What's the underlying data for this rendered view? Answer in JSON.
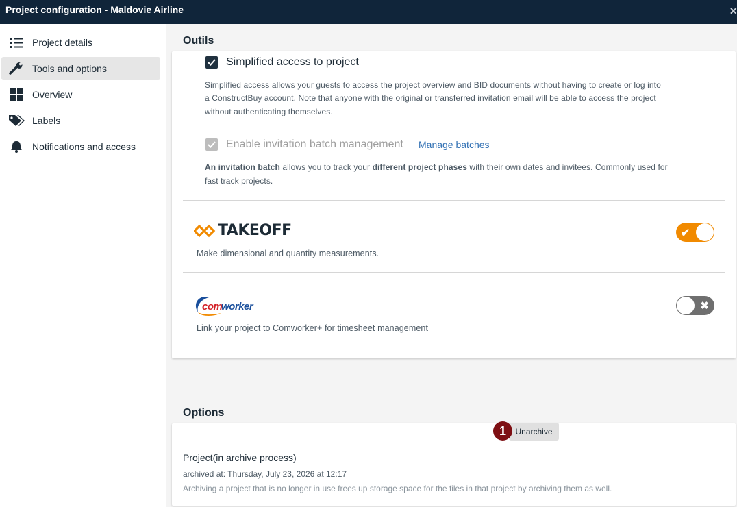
{
  "window": {
    "title": "Project configuration - Maldovie Airline",
    "close_glyph": "×"
  },
  "sidebar": {
    "items": [
      {
        "label": "Project details",
        "icon": "list-icon"
      },
      {
        "label": "Tools and options",
        "icon": "wrench-icon",
        "active": true
      },
      {
        "label": "Overview",
        "icon": "grid-icon"
      },
      {
        "label": "Labels",
        "icon": "tags-icon"
      },
      {
        "label": "Notifications and access",
        "icon": "bell-icon"
      }
    ]
  },
  "tools": {
    "section_title": "Outils",
    "simplified_access": {
      "label": "Simplified access to project",
      "checked": true,
      "description_1": "Simplified access allows your guests to access the project overview and BID documents without having to create or log into",
      "description_2": "a ConstructBuy account. Note that anyone with the original or transferred invitation email will be able to access the project",
      "description_3": "without authenticating themselves."
    },
    "batch": {
      "label": "Enable invitation batch management",
      "checked": true,
      "disabled": true,
      "link": "Manage batches",
      "desc_bold_1": "An invitation batch",
      "desc_text_1": " allows you to track your ",
      "desc_bold_2": "different project phases",
      "desc_text_2": " with their own dates and invitees. Commonly used for",
      "desc_line_2": "fast track projects."
    },
    "takeoff": {
      "logo_text": "TAKEOFF",
      "description": "Make dimensional and quantity measurements.",
      "enabled": true,
      "toggle_mark": "✔"
    },
    "comworker": {
      "logo_text_a": "com",
      "logo_text_b": "worker",
      "description": "Link your project to Comworker+ for timesheet management",
      "enabled": false,
      "toggle_mark": "✖"
    }
  },
  "options": {
    "section_title": "Options",
    "project_status": "Project(in archive process)",
    "archived_at": "archived at: Thursday, July 23, 2026 at 12:17",
    "archive_note": "Archiving a project that is no longer in use frees up storage space for the files in that project by archiving them as well.",
    "unarchive_label": "Unarchive",
    "badge_number": "1"
  },
  "colors": {
    "titlebar": "#10253a",
    "toggle_on": "#f18a00",
    "toggle_off": "#6f6f6f",
    "badge": "#7e0f13",
    "link": "#2f6fb3"
  }
}
